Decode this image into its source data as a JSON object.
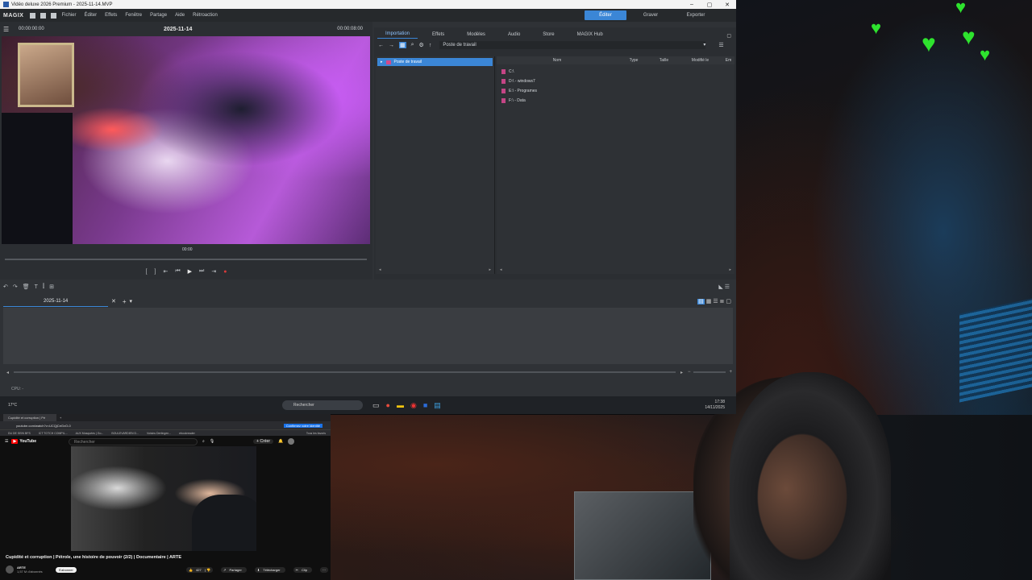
{
  "window": {
    "title": "Vidéo deluxe 2026 Premium - 2025-11-14.MVP",
    "controls": [
      "–",
      "▢",
      "✕"
    ]
  },
  "menubar": {
    "logo": "MAGIX",
    "items": [
      "Fichier",
      "Éditer",
      "Effets",
      "Fenêtre",
      "Partage",
      "Aide",
      "Rétroaction"
    ],
    "modes": [
      "Éditer",
      "Graver",
      "Exporter"
    ],
    "active_mode": "Éditer"
  },
  "player": {
    "timecode_left": "00:00:00:00",
    "project_title": "2025-11-14",
    "timecode_right": "00:00:08:00",
    "scrub_label": "00:00"
  },
  "media_pool": {
    "tabs": [
      "Importation",
      "Effets",
      "Modèles",
      "Audio",
      "Store",
      "MAGIX Hub"
    ],
    "active_tab": "Importation",
    "path": "Poste de travail",
    "tree_root": "Poste de travail",
    "columns": [
      "Nom",
      "Type",
      "Taille",
      "Modifié le",
      "Em"
    ],
    "drives": [
      "C:\\",
      "D:\\ - windows7",
      "E:\\ - Programes",
      "F:\\ - Data"
    ]
  },
  "timeline": {
    "project_tab": "2025-11-14"
  },
  "status": {
    "cpu": "CPU: -"
  },
  "taskbar": {
    "weather": "17°C",
    "search_placeholder": "Rechercher",
    "time": "17:38",
    "date": "14/11/2025"
  },
  "browser": {
    "tab_title": "Cupidité et corruption | Pé",
    "url": "youtube.com/watch?v=UCQjCeGvO-0",
    "badge": "Confirmez votre identité",
    "bookmarks": [
      "DU DE SEIN BFS",
      "ICT TOTCH COMPIL...",
      "AUX Mosquées | Go...",
      "BOULEVARDIEN D...",
      "Voisins Dertingen...",
      "ebookreader",
      "Tous les favoris"
    ],
    "yt_logo": "YouTube",
    "yt_search": "Rechercher",
    "yt_create": "Créer",
    "video_title": "Cupidité et corruption | Pétrole, une histoire de pouvoir (2/2) | Documentaire | ARTE",
    "channel": "ARTE",
    "subscribers": "1,57 M d'abonnés",
    "subscribe": "S'abonner",
    "likes": "427",
    "actions": [
      "Partager",
      "Télécharger",
      "Clip"
    ]
  }
}
